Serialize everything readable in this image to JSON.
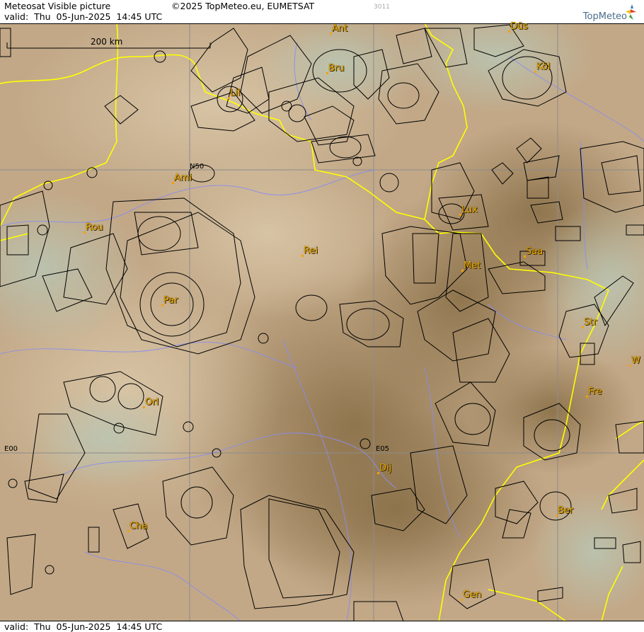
{
  "header": {
    "title": "Meteosat Visible picture",
    "copyright": "©2025 TopMeteo.eu, EUMETSAT",
    "code": "3011",
    "valid": "valid:  Thu  05-Jun-2025  14:45 UTC",
    "brand": "TopMeteo"
  },
  "footer": {
    "valid": "valid:  Thu  05-Jun-2025  14:45 UTC"
  },
  "scale": {
    "label": "200 km"
  },
  "grid_labels": {
    "n50": "N50",
    "e00": "E00",
    "e05": "E05"
  },
  "cities": [
    {
      "id": "ant",
      "label": "Ant"
    },
    {
      "id": "dus",
      "label": "Düs"
    },
    {
      "id": "bru",
      "label": "Bru"
    },
    {
      "id": "kol",
      "label": "Köl"
    },
    {
      "id": "lil",
      "label": "Lil"
    },
    {
      "id": "ami",
      "label": "Ami"
    },
    {
      "id": "rou",
      "label": "Rou"
    },
    {
      "id": "lux",
      "label": "Lux"
    },
    {
      "id": "rei",
      "label": "Rei"
    },
    {
      "id": "saa",
      "label": "Saa"
    },
    {
      "id": "met",
      "label": "Met"
    },
    {
      "id": "par",
      "label": "Par"
    },
    {
      "id": "str",
      "label": "Str"
    },
    {
      "id": "fre",
      "label": "Fre"
    },
    {
      "id": "orl",
      "label": "Orl"
    },
    {
      "id": "dij",
      "label": "Dij"
    },
    {
      "id": "ber",
      "label": "Ber"
    },
    {
      "id": "cha",
      "label": "Cha"
    },
    {
      "id": "gen",
      "label": "Gen"
    },
    {
      "id": "w",
      "label": "W"
    }
  ],
  "colors": {
    "terrain_light": "#cdb698",
    "terrain_dark": "#8a7048",
    "cloud_haze": "#b9c6b4",
    "border": "#ffff00",
    "river": "#8a8cf0",
    "city_label": "#f5b100",
    "airspace": "#000000",
    "grid": "#8c8c8c"
  }
}
